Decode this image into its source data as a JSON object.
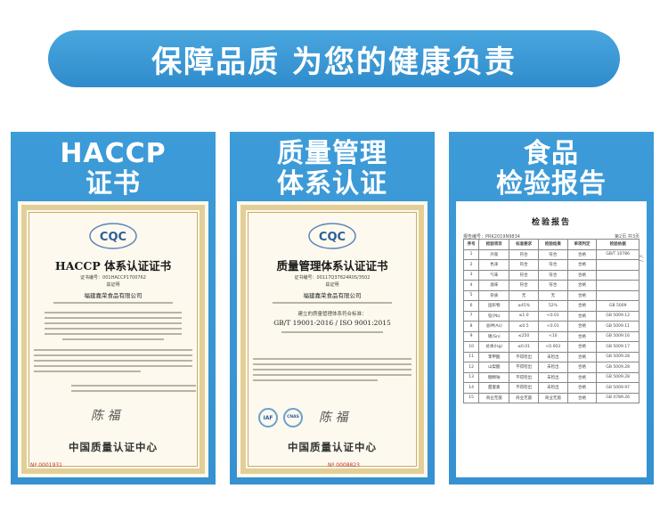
{
  "banner": {
    "text": "保障品质 为您的健康负责"
  },
  "cards": [
    {
      "title_line1": "HACCP",
      "title_line2": "证书"
    },
    {
      "title_line1": "质量管理",
      "title_line2": "体系认证"
    },
    {
      "title_line1": "食品",
      "title_line2": "检验报告"
    }
  ],
  "haccp": {
    "logo": "CQC",
    "title": "HACCP 体系认证证书",
    "cert_no": "证书编号：001HACCP1700762",
    "issued": "兹证明",
    "company": "福建嘉荣食品有限公司",
    "center": "中国质量认证中心",
    "serial": "Nº 0001931",
    "serial_right": "0001931"
  },
  "qms": {
    "logo": "CQC",
    "title": "质量管理体系认证证书",
    "cert_no": "证书编号：00117Q37824R0S/3502",
    "issued": "兹证明",
    "company": "福建嘉荣食品有限公司",
    "text1": "建立的质量管理体系符合标准：",
    "standard": "GB/T 19001-2016 / ISO 9001:2015",
    "iaf": "IAF",
    "cnas": "CNAS",
    "center": "中国质量认证中心",
    "serial": "Nº 0008823"
  },
  "report": {
    "title": "检验报告",
    "report_no": "报告编号：PRK2019N9834",
    "page": "第2页 共3页",
    "rows": [
      [
        "序号",
        "检验项目",
        "标准要求",
        "检验结果",
        "单项判定",
        "检验依据"
      ],
      [
        "1",
        "外观",
        "符合",
        "符合",
        "合格",
        "GB/T 10786"
      ],
      [
        "2",
        "色泽",
        "符合",
        "符合",
        "合格",
        ""
      ],
      [
        "3",
        "气味",
        "符合",
        "符合",
        "合格",
        ""
      ],
      [
        "4",
        "滋味",
        "符合",
        "符合",
        "合格",
        ""
      ],
      [
        "5",
        "杂质",
        "无",
        "无",
        "合格",
        ""
      ],
      [
        "6",
        "固形物",
        "≥45%",
        "52%",
        "合格",
        "GB 5009"
      ],
      [
        "7",
        "铅(Pb)",
        "≤1.0",
        "<0.01",
        "合格",
        "GB 5009.12"
      ],
      [
        "8",
        "总砷(As)",
        "≤0.5",
        "<0.01",
        "合格",
        "GB 5009.11"
      ],
      [
        "9",
        "锡(Sn)",
        "≤250",
        "<10",
        "合格",
        "GB 5009.16"
      ],
      [
        "10",
        "总汞(Hg)",
        "≤0.01",
        "<0.003",
        "合格",
        "GB 5009.17"
      ],
      [
        "11",
        "苯甲酸",
        "不得检出",
        "未检出",
        "合格",
        "GB 5009.28"
      ],
      [
        "12",
        "山梨酸",
        "不得检出",
        "未检出",
        "合格",
        "GB 5009.28"
      ],
      [
        "13",
        "糖精钠",
        "不得检出",
        "未检出",
        "合格",
        "GB 5009.28"
      ],
      [
        "14",
        "甜蜜素",
        "不得检出",
        "未检出",
        "合格",
        "GB 5009.97"
      ],
      [
        "15",
        "商业无菌",
        "商业无菌",
        "商业无菌",
        "合格",
        "GB 4789.26"
      ]
    ]
  }
}
